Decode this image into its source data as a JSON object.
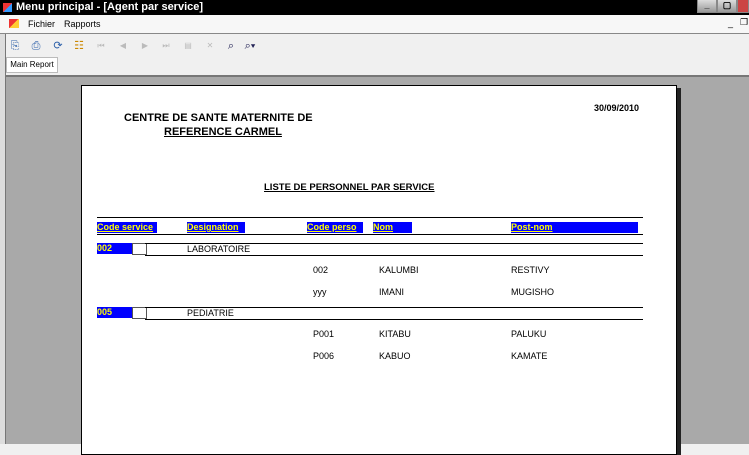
{
  "window": {
    "title": "Menu principal - [Agent par service]"
  },
  "menubar": {
    "items": [
      "Fichier",
      "Rapports"
    ]
  },
  "toolbar": {
    "icons": [
      "export-icon",
      "print-icon",
      "refresh-icon",
      "group-tree-icon",
      "first-page-icon",
      "previous-page-icon",
      "next-page-icon",
      "last-page-icon",
      "goto-page-icon",
      "close-view-icon",
      "find-icon",
      "zoom-icon"
    ]
  },
  "tabs": [
    {
      "label": "Main Report"
    }
  ],
  "report": {
    "org_line1": "CENTRE DE SANTE MATERNITE DE",
    "org_line2": "REFERENCE CARMEL",
    "date": "30/09/2010",
    "title": "LISTE DE PERSONNEL PAR SERVICE",
    "columns": [
      "Code service",
      "Designation",
      "Code perso",
      "Nom",
      "Post-nom"
    ],
    "groups": [
      {
        "code": "002",
        "designation": "LABORATOIRE",
        "rows": [
          {
            "code": "002",
            "nom": "KALUMBI",
            "postnom": "RESTIVY"
          },
          {
            "code": "yyy",
            "nom": "IMANI",
            "postnom": "MUGISHO"
          }
        ]
      },
      {
        "code": "005",
        "designation": "PEDIATRIE",
        "rows": [
          {
            "code": "P001",
            "nom": "KITABU",
            "postnom": "PALUKU"
          },
          {
            "code": "P006",
            "nom": "KABUO",
            "postnom": "KAMATE"
          }
        ]
      }
    ]
  },
  "colors": {
    "header_bg": "#0000ff",
    "header_fg": "#ffff00"
  }
}
